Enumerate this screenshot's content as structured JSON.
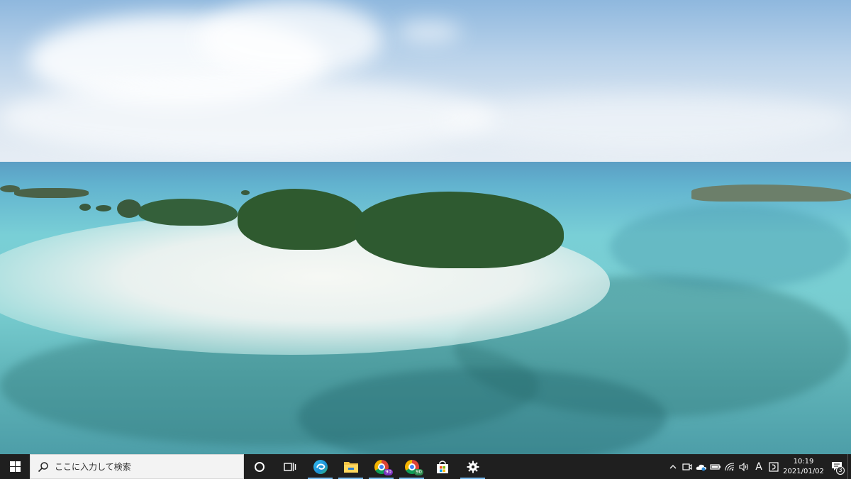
{
  "desktop": {
    "wallpaper": "tropical-island-aerial"
  },
  "taskbar": {
    "search": {
      "placeholder": "ここに入力して検索"
    },
    "pinned": [
      {
        "name": "microsoft-edge",
        "icon": "edge-icon"
      },
      {
        "name": "file-explorer",
        "icon": "folder-icon"
      },
      {
        "name": "chrome-profile-1",
        "icon": "chrome-icon",
        "badge": "90"
      },
      {
        "name": "chrome-profile-2",
        "icon": "chrome-icon",
        "badge": "90"
      },
      {
        "name": "microsoft-store",
        "icon": "store-bag-icon"
      },
      {
        "name": "settings",
        "icon": "gear-icon"
      }
    ],
    "tray": {
      "ime_label": "A",
      "time": "10:19",
      "date": "2021/01/02",
      "notification_count": "3"
    }
  },
  "colors": {
    "taskbar_bg": "#1f1f1f",
    "active_indicator": "#76b9ed",
    "search_bg": "#f3f3f3"
  }
}
